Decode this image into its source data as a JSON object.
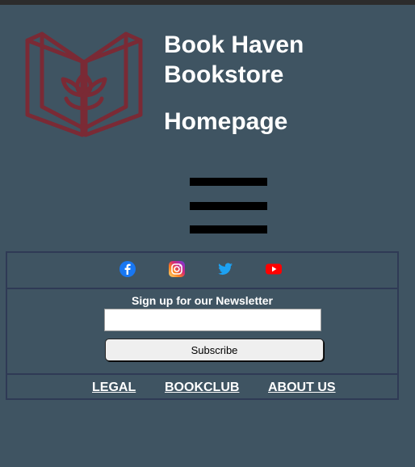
{
  "header": {
    "title_line1": "Book Haven",
    "title_line2": "Bookstore",
    "subtitle": "Homepage",
    "logo_color": "#7a2a35"
  },
  "menu": {
    "icon": "hamburger-menu-icon"
  },
  "social": [
    {
      "name": "facebook-icon",
      "color": "#1877f2"
    },
    {
      "name": "instagram-icon",
      "color": "#e1306c"
    },
    {
      "name": "twitter-icon",
      "color": "#1da1f2"
    },
    {
      "name": "youtube-icon",
      "color": "#ff0000"
    }
  ],
  "newsletter": {
    "heading": "Sign up for our Newsletter",
    "input_value": "",
    "button_label": "Subscribe"
  },
  "footer_links": [
    "LEGAL",
    "BOOKCLUB",
    "ABOUT US"
  ],
  "colors": {
    "background": "#3f5462",
    "border": "#2f3a55"
  }
}
